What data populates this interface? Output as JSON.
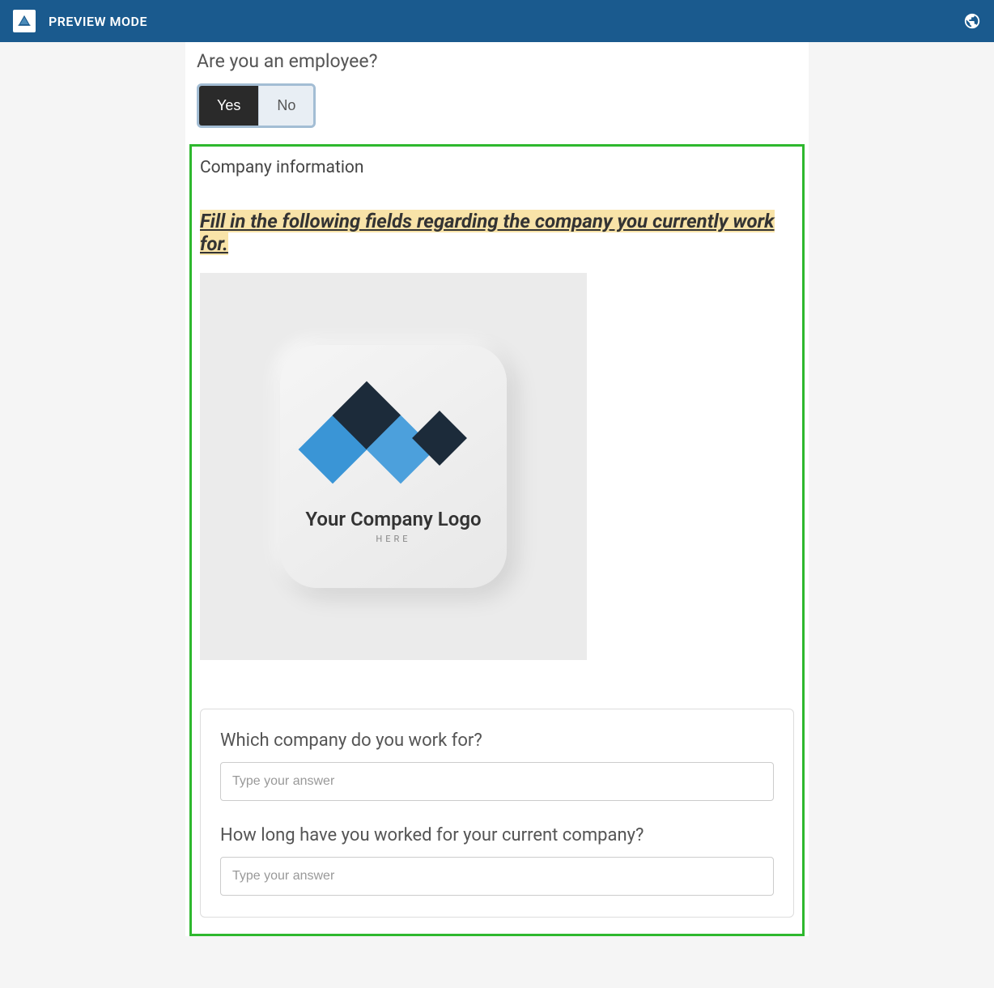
{
  "header": {
    "title": "PREVIEW MODE"
  },
  "question1": {
    "label": "Are you an employee?",
    "yes": "Yes",
    "no": "No"
  },
  "section": {
    "title": "Company information",
    "instruction": "Fill in the following fields regarding the company you currently work for.",
    "logo": {
      "main": "Your Company Logo",
      "sub": "HERE"
    }
  },
  "fields": {
    "company": {
      "label": "Which company do you work for?",
      "placeholder": "Type your answer"
    },
    "duration": {
      "label": "How long have you worked for your current company?",
      "placeholder": "Type your answer"
    }
  }
}
